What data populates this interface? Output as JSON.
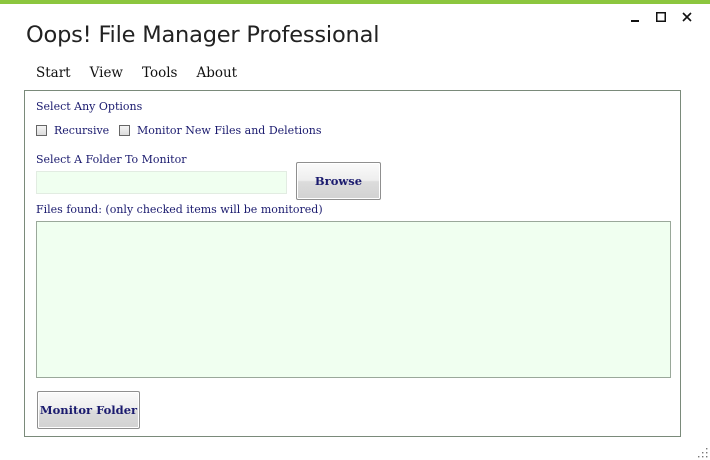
{
  "window": {
    "title": "Oops! File Manager Professional",
    "accent_color": "#8cc63e",
    "controls": [
      {
        "name": "minimize-icon"
      },
      {
        "name": "maximize-icon"
      },
      {
        "name": "close-icon"
      }
    ]
  },
  "menu": {
    "items": [
      "Start",
      "View",
      "Tools",
      "About"
    ]
  },
  "options": {
    "heading": "Select Any Options",
    "recursive_label": "Recursive",
    "recursive_checked": false,
    "monitor_label": "Monitor New Files and Deletions",
    "monitor_checked": false
  },
  "folder": {
    "label": "Select A Folder To Monitor",
    "value": "",
    "browse_label": "Browse"
  },
  "files": {
    "label": "Files found: (only checked items will be monitored)",
    "items": []
  },
  "actions": {
    "monitor_label": "Monitor Folder"
  }
}
